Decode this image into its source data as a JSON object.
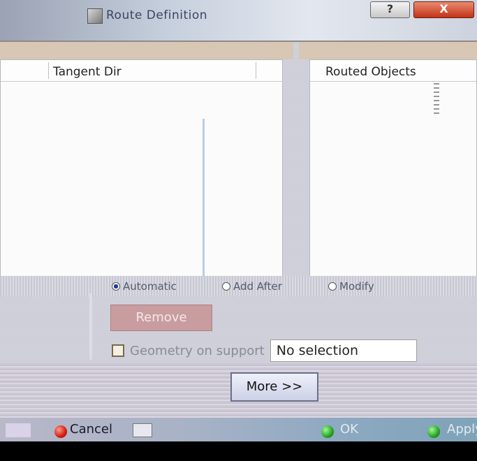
{
  "window": {
    "title": "Route Definition",
    "help_label": "?",
    "close_label": "X"
  },
  "left_panel": {
    "column_header": "Tangent Dir"
  },
  "right_panel": {
    "column_header": "Routed Objects"
  },
  "options": [
    {
      "label": "Automatic",
      "selected": true
    },
    {
      "label": "Add After",
      "selected": false
    },
    {
      "label": "Modify",
      "selected": false
    }
  ],
  "remove_button": "Remove",
  "geometry_on_support": {
    "label": "Geometry on support",
    "checked": false,
    "value": "No selection"
  },
  "more_button": "More >>",
  "footer": {
    "cancel": "Cancel",
    "ok": "OK",
    "apply": "Apply"
  },
  "colors": {
    "remove_button": "#c99da0",
    "cancel_icon": "#d21d10",
    "ok_icon": "#22a51f",
    "selection_accent": "#1b3f9a"
  }
}
